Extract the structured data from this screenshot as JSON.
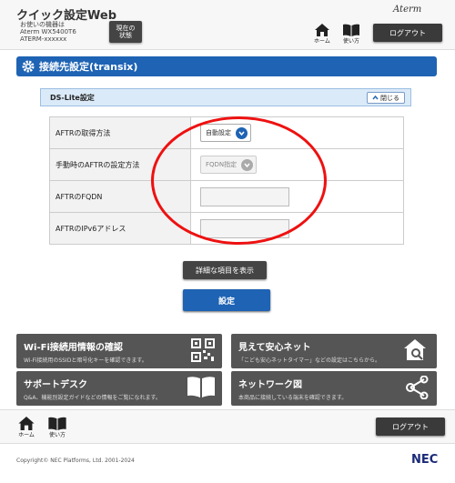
{
  "header": {
    "title": "クイック設定Web",
    "device_line1": "お使いの機器は",
    "device_line2": "Aterm WX5400T6",
    "device_line3": "ATERM-xxxxxx",
    "status_line1": "現在の",
    "status_line2": "状態",
    "logo": "Aterm",
    "home_label": "ホーム",
    "help_label": "使い方",
    "logout_label": "ログアウト"
  },
  "page": {
    "heading": "接続先設定(transix)",
    "section_title": "DS-Lite設定",
    "close_label": "閉じる"
  },
  "form": {
    "rows": [
      {
        "label": "AFTRの取得方法",
        "value": "自動設定"
      },
      {
        "label": "手動時のAFTRの設定方法",
        "value": "FQDN指定"
      },
      {
        "label": "AFTRのFQDN",
        "value": ""
      },
      {
        "label": "AFTRのIPv6アドレス",
        "value": ""
      }
    ]
  },
  "actions": {
    "detail_label": "詳細な項目を表示",
    "submit_label": "設定"
  },
  "tiles": [
    {
      "title": "Wi-Fi接続用情報の確認",
      "desc": "Wi-Fi接続用のSSIDと暗号化キーを確認できます。",
      "icon": "qr-code-icon"
    },
    {
      "title": "見えて安心ネット",
      "desc": "「こども安心ネットタイマー」などの設定はこちらから。",
      "icon": "home-search-icon"
    },
    {
      "title": "サポートデスク",
      "desc": "Q&A、機能別設定ガイドなどの情報をご覧になれます。",
      "icon": "book-icon"
    },
    {
      "title": "ネットワーク図",
      "desc": "本商品に接続している端末を確認できます。",
      "icon": "share-network-icon"
    }
  ],
  "footer": {
    "home_label": "ホーム",
    "help_label": "使い方",
    "logout_label": "ログアウト",
    "copyright": "Copyright© NEC Platforms, Ltd. 2001-2024",
    "brand": "NEC"
  },
  "colors": {
    "accent": "#1e63b4",
    "annotation": "#ee1111",
    "dark_button": "#444444"
  }
}
